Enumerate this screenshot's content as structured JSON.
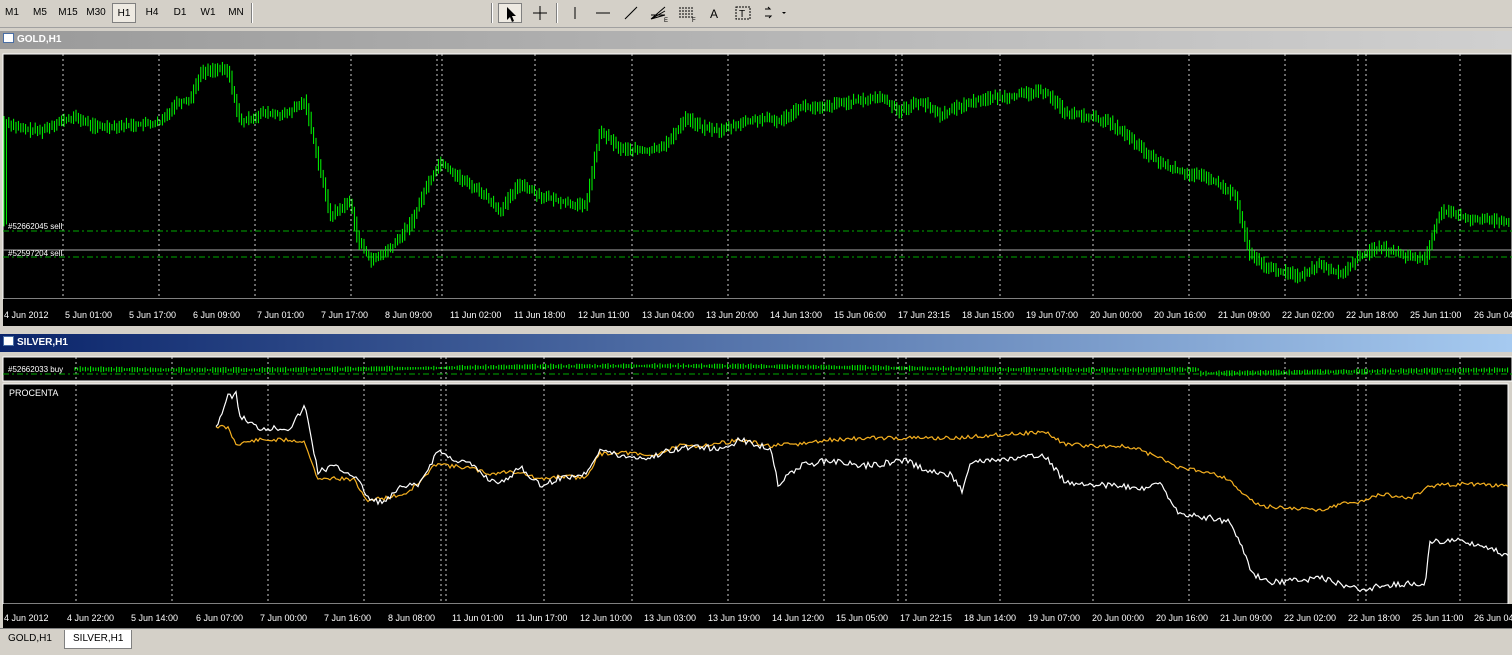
{
  "toolbar": {
    "timeframes": [
      "M1",
      "M5",
      "M15",
      "M30",
      "H1",
      "H4",
      "D1",
      "W1",
      "MN"
    ],
    "active_timeframe": "H1",
    "tools": [
      "cursor-icon",
      "crosshair-icon",
      "vertical-line-icon",
      "horizontal-line-icon",
      "trendline-icon",
      "fibo-fan-icon",
      "fibo-retracement-icon",
      "text-label-icon",
      "text-box-icon",
      "arrows-icon"
    ]
  },
  "gold_window": {
    "title": "GOLD,H1",
    "orders": [
      {
        "label": "#52662045 sell"
      },
      {
        "label": "#52597204 sell"
      }
    ],
    "time_labels": [
      "4 Jun 2012",
      "5 Jun 01:00",
      "5 Jun 17:00",
      "6 Jun 09:00",
      "7 Jun 01:00",
      "7 Jun 17:00",
      "8 Jun 09:00",
      "11 Jun 02:00",
      "11 Jun 18:00",
      "12 Jun 11:00",
      "13 Jun 04:00",
      "13 Jun 20:00",
      "14 Jun 13:00",
      "15 Jun 06:00",
      "17 Jun 23:15",
      "18 Jun 15:00",
      "19 Jun 07:00",
      "20 Jun 00:00",
      "20 Jun 16:00",
      "21 Jun 09:00",
      "22 Jun 02:00",
      "22 Jun 18:00",
      "25 Jun 11:00",
      "26 Jun 04:"
    ],
    "colors": {
      "bars": "#00ff00",
      "background": "#000000",
      "grid": "#ffffff",
      "order_line": "#00aa00"
    }
  },
  "silver_window": {
    "title": "SILVER,H1",
    "order": {
      "label": "#52662033 buy"
    },
    "indicator_label": "PROCENTA",
    "time_labels": [
      "4 Jun 2012",
      "4 Jun 22:00",
      "5 Jun 14:00",
      "6 Jun 07:00",
      "7 Jun 00:00",
      "7 Jun 16:00",
      "8 Jun 08:00",
      "11 Jun 01:00",
      "11 Jun 17:00",
      "12 Jun 10:00",
      "13 Jun 03:00",
      "13 Jun 19:00",
      "14 Jun 12:00",
      "15 Jun 05:00",
      "17 Jun 22:15",
      "18 Jun 14:00",
      "19 Jun 07:00",
      "20 Jun 00:00",
      "20 Jun 16:00",
      "21 Jun 09:00",
      "22 Jun 02:00",
      "22 Jun 18:00",
      "25 Jun 11:00",
      "26 Jun 04:"
    ],
    "colors": {
      "line_a": "#ffffff",
      "line_b": "#f5b020",
      "bars": "#00ff00"
    }
  },
  "tabs": [
    {
      "label": "GOLD,H1",
      "active": false
    },
    {
      "label": "SILVER,H1",
      "active": true
    }
  ]
}
